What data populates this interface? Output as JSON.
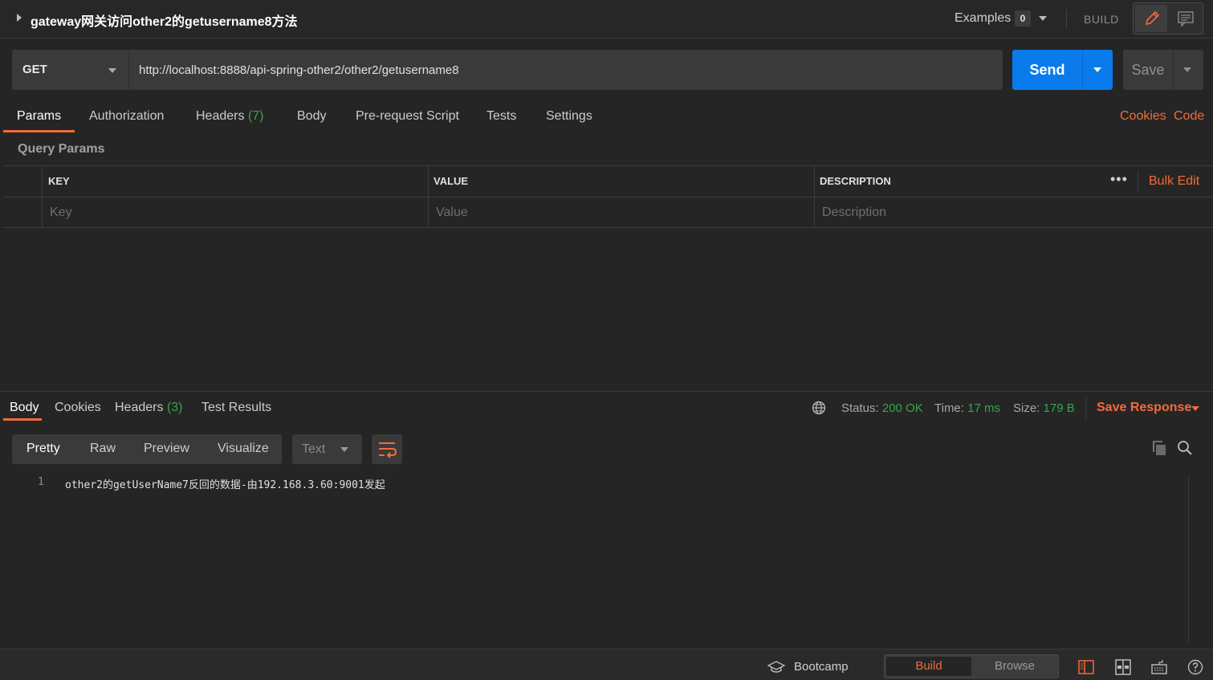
{
  "request": {
    "title": "gateway网关访问other2的getusername8方法",
    "examples_label": "Examples",
    "examples_count": "0",
    "build_label": "BUILD",
    "method": "GET",
    "url": "http://localhost:8888/api-spring-other2/other2/getusername8",
    "send_label": "Send",
    "save_label": "Save"
  },
  "request_tabs": {
    "params": "Params",
    "authorization": "Authorization",
    "headers": "Headers",
    "headers_count": "(7)",
    "body": "Body",
    "prerequest": "Pre-request Script",
    "tests": "Tests",
    "settings": "Settings",
    "cookies": "Cookies",
    "code": "Code"
  },
  "params": {
    "section_title": "Query Params",
    "columns": {
      "key": "KEY",
      "value": "VALUE",
      "description": "DESCRIPTION"
    },
    "placeholders": {
      "key": "Key",
      "value": "Value",
      "description": "Description"
    },
    "more": "•••",
    "bulk_edit": "Bulk Edit"
  },
  "response": {
    "tabs": {
      "body": "Body",
      "cookies": "Cookies",
      "headers": "Headers",
      "headers_count": "(3)",
      "test_results": "Test Results"
    },
    "status_label": "Status:",
    "status_value": "200 OK",
    "time_label": "Time:",
    "time_value": "17 ms",
    "size_label": "Size:",
    "size_value": "179 B",
    "save_response": "Save Response",
    "views": {
      "pretty": "Pretty",
      "raw": "Raw",
      "preview": "Preview",
      "visualize": "Visualize"
    },
    "format": "Text",
    "lines": [
      {
        "number": "1",
        "text": "other2的getUserName7反回的数据-由192.168.3.60:9001发起"
      }
    ]
  },
  "statusbar": {
    "bootcamp": "Bootcamp",
    "build": "Build",
    "browse": "Browse"
  },
  "colors": {
    "accent": "#f26b3a",
    "send": "#097bed",
    "success": "#36a54b",
    "background": "#252525"
  },
  "icons": [
    "caret-right-icon",
    "pencil-icon",
    "comment-icon",
    "globe-icon",
    "wrap-lines-icon",
    "copy-icon",
    "search-icon",
    "graduation-cap-icon",
    "two-pane-icon",
    "layout-icon",
    "keyboard-icon",
    "help-icon"
  ]
}
